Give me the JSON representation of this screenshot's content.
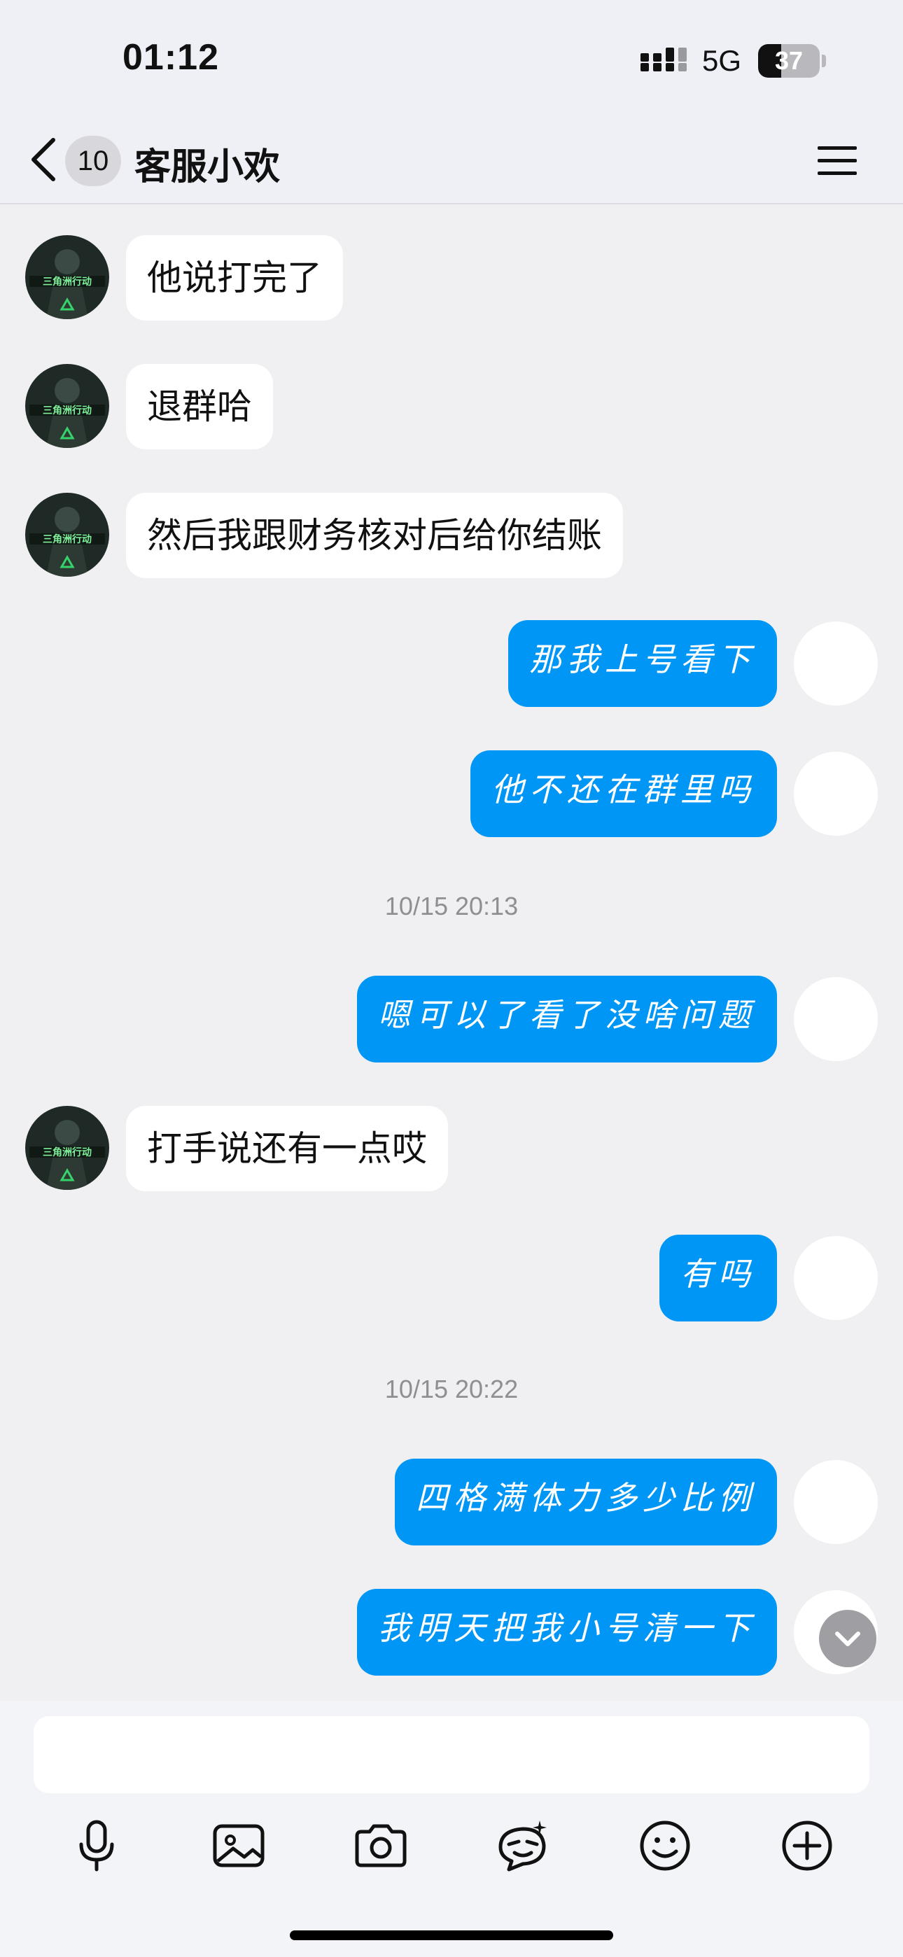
{
  "status_bar": {
    "time": "01:12",
    "network": "5G",
    "battery_level": "37",
    "battery_fraction": 0.37
  },
  "nav": {
    "back_icon": "chevron-left-icon",
    "unread_count": "10",
    "title": "客服小欢",
    "menu_icon": "hamburger-menu-icon"
  },
  "messages": [
    {
      "side": "left",
      "text": "他说打完了"
    },
    {
      "side": "left",
      "text": "退群哈"
    },
    {
      "side": "left",
      "text": "然后我跟财务核对后给你结账"
    },
    {
      "side": "right",
      "text": "那我上号看下"
    },
    {
      "side": "right",
      "text": "他不还在群里吗"
    },
    {
      "type": "time",
      "text": "10/15 20:13"
    },
    {
      "side": "right",
      "text": "嗯可以了看了没啥问题"
    },
    {
      "side": "left",
      "text": "打手说还有一点哎"
    },
    {
      "side": "right",
      "text": "有吗"
    },
    {
      "type": "time",
      "text": "10/15 20:22"
    },
    {
      "side": "right",
      "text": "四格满体力多少比例"
    },
    {
      "side": "right",
      "text": "我明天把我小号清一下"
    }
  ],
  "avatar_left_label": "三角洲行动",
  "input": {
    "placeholder": ""
  },
  "toolbar": [
    "microphone-icon",
    "image-icon",
    "camera-icon",
    "sticker-icon",
    "emoji-icon",
    "plus-icon"
  ],
  "colors": {
    "outgoing_bubble": "#0096f5",
    "incoming_bubble": "#ffffff",
    "background": "#f0f0f2"
  }
}
